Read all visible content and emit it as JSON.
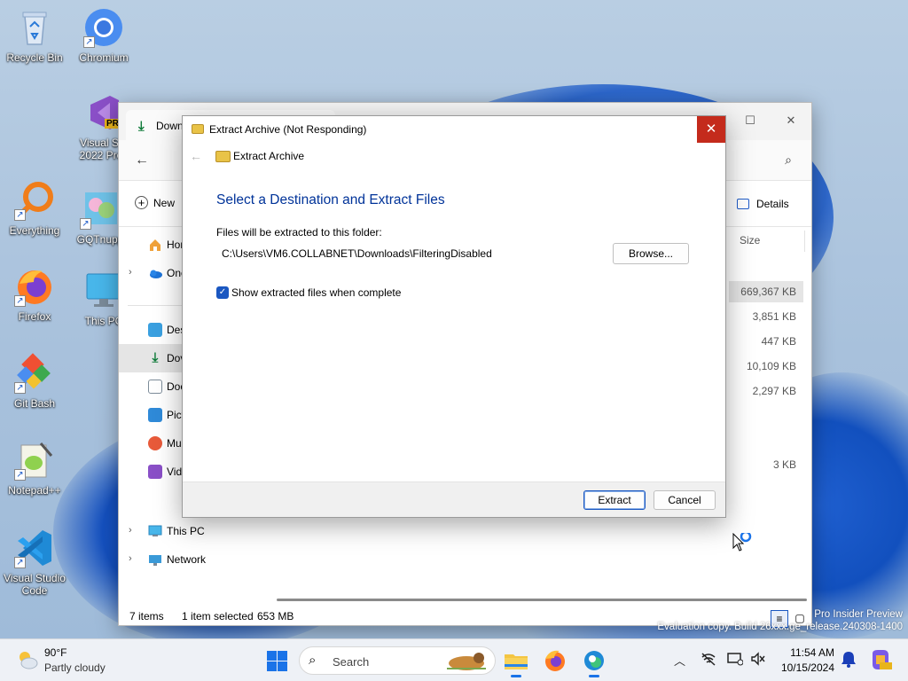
{
  "desktop": {
    "icons": [
      {
        "label": "Recycle Bin",
        "icon": "recycle-bin-icon"
      },
      {
        "label": "Chromium",
        "icon": "chromium-icon"
      },
      {
        "label": "Visual Studio 2022 Preview",
        "label_line1": "Visual Stu",
        "label_line2": "2022 Prev",
        "icon": "visual-studio-preview-icon",
        "badge": "PRE"
      },
      {
        "label": "Everything",
        "icon": "everything-search-icon"
      },
      {
        "label": "GQTnupp",
        "icon": "gqtnupp-icon"
      },
      {
        "label": "Firefox",
        "icon": "firefox-icon"
      },
      {
        "label": "This PC",
        "icon": "this-pc-icon"
      },
      {
        "label": "Git Bash",
        "icon": "git-bash-icon"
      },
      {
        "label": "Notepad++",
        "icon": "notepad-plus-plus-icon"
      },
      {
        "label": "Visual Studio Code",
        "label_line1": "Visual Studio",
        "label_line2": "Code",
        "icon": "vscode-icon"
      }
    ]
  },
  "explorer": {
    "tab_title": "Down",
    "new_label": "New",
    "details_label": "Details",
    "column_size": "Size",
    "nav": [
      {
        "label": "Hor",
        "icon": "home-icon",
        "chevron": false
      },
      {
        "label": "Onc",
        "icon": "onedrive-icon",
        "chevron": true
      },
      {
        "label": "Des",
        "icon": "desktop-folder-icon",
        "chevron": false
      },
      {
        "label": "Dov",
        "icon": "downloads-icon",
        "chevron": false,
        "selected": true
      },
      {
        "label": "Doc",
        "icon": "documents-icon",
        "chevron": false
      },
      {
        "label": "Pict",
        "icon": "pictures-icon",
        "chevron": false
      },
      {
        "label": "Mu",
        "icon": "music-icon",
        "chevron": false
      },
      {
        "label": "Vid",
        "icon": "videos-icon",
        "chevron": false
      },
      {
        "label": "This PC",
        "icon": "this-pc-icon",
        "chevron": true
      },
      {
        "label": "Network",
        "icon": "network-icon",
        "chevron": true
      }
    ],
    "sizes": [
      "669,367 KB",
      "3,851 KB",
      "447 KB",
      "10,109 KB",
      "2,297 KB",
      "3 KB"
    ],
    "status": {
      "items": "7 items",
      "selected": "1 item selected",
      "size": "653 MB"
    }
  },
  "dialog": {
    "title": "Extract Archive (Not Responding)",
    "nav_title": "Extract Archive",
    "heading": "Select a Destination and Extract Files",
    "dest_label": "Files will be extracted to this folder:",
    "path": "C:\\Users\\VM6.COLLABNET\\Downloads\\FilteringDisabled",
    "browse": "Browse...",
    "checkbox_label": "Show extracted files when complete",
    "checkbox_checked": true,
    "extract": "Extract",
    "cancel": "Cancel",
    "close_color": "#c42b1c",
    "heading_color": "#003399"
  },
  "watermark": {
    "line1": "Pro Insider Preview",
    "line2": "Evaluation copy. Build 26xxx.ge_release.240308-1400"
  },
  "taskbar": {
    "weather_temp": "90°F",
    "weather_desc": "Partly cloudy",
    "search_placeholder": "Search",
    "time": "11:54 AM",
    "date": "10/15/2024",
    "accent": "#1a73e8"
  }
}
